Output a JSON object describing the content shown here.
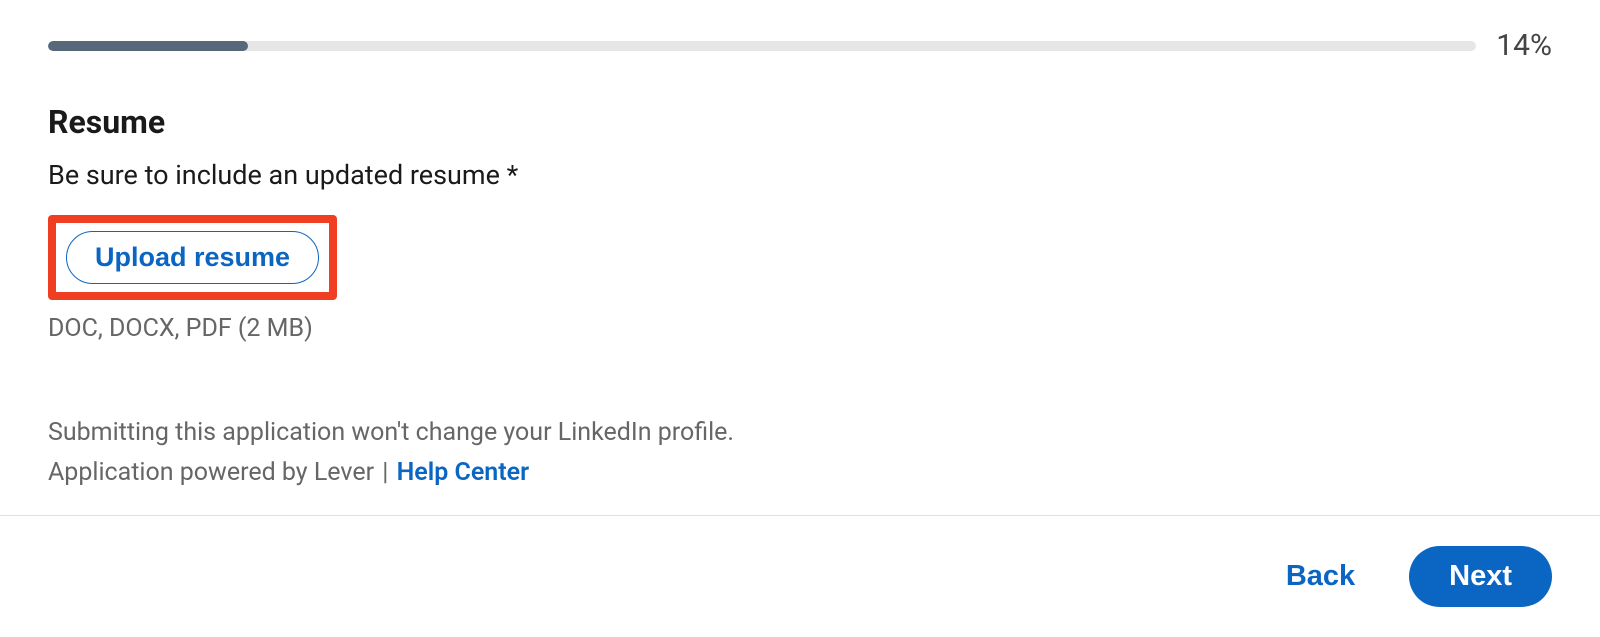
{
  "progress": {
    "percent_label": "14%",
    "percent_value": 14
  },
  "section": {
    "title": "Resume",
    "subtitle": "Be sure to include an updated resume *",
    "upload_label": "Upload resume",
    "file_hint": "DOC, DOCX, PDF (2 MB)"
  },
  "footer": {
    "note": "Submitting this application won't change your LinkedIn profile.",
    "powered_by": "Application powered by Lever",
    "separator": " | ",
    "help_link_label": "Help Center"
  },
  "buttons": {
    "back": "Back",
    "next": "Next"
  }
}
